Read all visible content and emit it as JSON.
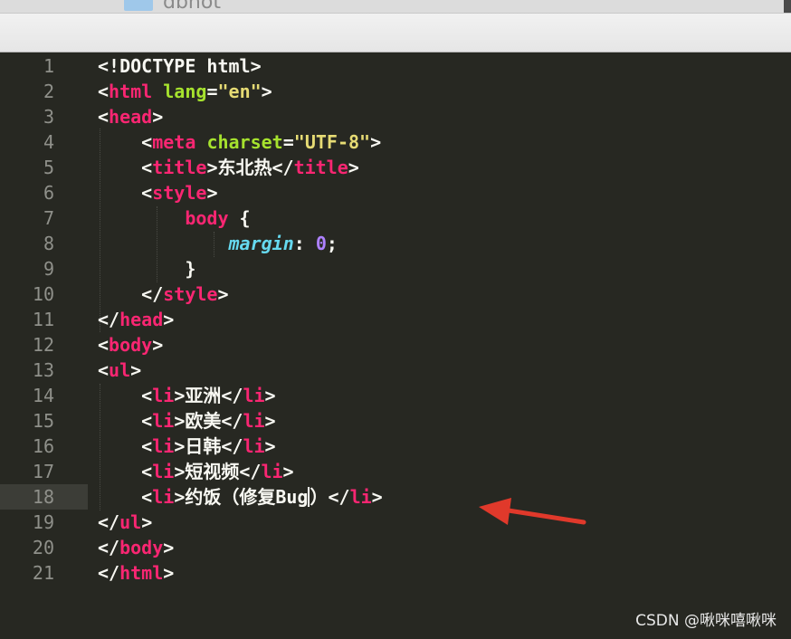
{
  "finder": {
    "folder_name": "dbhot"
  },
  "editor": {
    "active_line": "18",
    "lines": [
      {
        "num": "1",
        "segs": [
          {
            "c": "w",
            "t": "<!DOCTYPE html>"
          }
        ]
      },
      {
        "num": "2",
        "segs": [
          {
            "c": "w",
            "t": "<"
          },
          {
            "c": "t",
            "t": "html"
          },
          {
            "c": "w",
            "t": " "
          },
          {
            "c": "a",
            "t": "lang"
          },
          {
            "c": "w",
            "t": "="
          },
          {
            "c": "s",
            "t": "\"en\""
          },
          {
            "c": "w",
            "t": ">"
          }
        ]
      },
      {
        "num": "3",
        "segs": [
          {
            "c": "w",
            "t": "<"
          },
          {
            "c": "t",
            "t": "head"
          },
          {
            "c": "w",
            "t": ">"
          }
        ]
      },
      {
        "num": "4",
        "segs": [
          {
            "c": "w",
            "t": "    <"
          },
          {
            "c": "t",
            "t": "meta"
          },
          {
            "c": "w",
            "t": " "
          },
          {
            "c": "a",
            "t": "charset"
          },
          {
            "c": "w",
            "t": "="
          },
          {
            "c": "s",
            "t": "\"UTF-8\""
          },
          {
            "c": "w",
            "t": ">"
          }
        ]
      },
      {
        "num": "5",
        "segs": [
          {
            "c": "w",
            "t": "    <"
          },
          {
            "c": "t",
            "t": "title"
          },
          {
            "c": "w",
            "t": ">东北热</"
          },
          {
            "c": "t",
            "t": "title"
          },
          {
            "c": "w",
            "t": ">"
          }
        ]
      },
      {
        "num": "6",
        "segs": [
          {
            "c": "w",
            "t": "    <"
          },
          {
            "c": "t",
            "t": "style"
          },
          {
            "c": "w",
            "t": ">"
          }
        ]
      },
      {
        "num": "7",
        "segs": [
          {
            "c": "w",
            "t": "        "
          },
          {
            "c": "t",
            "t": "body"
          },
          {
            "c": "w",
            "t": " {"
          }
        ]
      },
      {
        "num": "8",
        "segs": [
          {
            "c": "w",
            "t": "            "
          },
          {
            "c": "p",
            "t": "margin"
          },
          {
            "c": "w",
            "t": ": "
          },
          {
            "c": "n",
            "t": "0"
          },
          {
            "c": "w",
            "t": ";"
          }
        ]
      },
      {
        "num": "9",
        "segs": [
          {
            "c": "w",
            "t": "        }"
          }
        ]
      },
      {
        "num": "10",
        "segs": [
          {
            "c": "w",
            "t": "    </"
          },
          {
            "c": "t",
            "t": "style"
          },
          {
            "c": "w",
            "t": ">"
          }
        ]
      },
      {
        "num": "11",
        "segs": [
          {
            "c": "w",
            "t": "</"
          },
          {
            "c": "t",
            "t": "head"
          },
          {
            "c": "w",
            "t": ">"
          }
        ]
      },
      {
        "num": "12",
        "segs": [
          {
            "c": "w",
            "t": "<"
          },
          {
            "c": "t",
            "t": "body"
          },
          {
            "c": "w",
            "t": ">"
          }
        ]
      },
      {
        "num": "13",
        "segs": [
          {
            "c": "w",
            "t": "<"
          },
          {
            "c": "t",
            "t": "ul"
          },
          {
            "c": "w",
            "t": ">"
          }
        ]
      },
      {
        "num": "14",
        "segs": [
          {
            "c": "w",
            "t": "    <"
          },
          {
            "c": "t",
            "t": "li"
          },
          {
            "c": "w",
            "t": ">亚洲</"
          },
          {
            "c": "t",
            "t": "li"
          },
          {
            "c": "w",
            "t": ">"
          }
        ]
      },
      {
        "num": "15",
        "segs": [
          {
            "c": "w",
            "t": "    <"
          },
          {
            "c": "t",
            "t": "li"
          },
          {
            "c": "w",
            "t": ">欧美</"
          },
          {
            "c": "t",
            "t": "li"
          },
          {
            "c": "w",
            "t": ">"
          }
        ]
      },
      {
        "num": "16",
        "segs": [
          {
            "c": "w",
            "t": "    <"
          },
          {
            "c": "t",
            "t": "li"
          },
          {
            "c": "w",
            "t": ">日韩</"
          },
          {
            "c": "t",
            "t": "li"
          },
          {
            "c": "w",
            "t": ">"
          }
        ]
      },
      {
        "num": "17",
        "segs": [
          {
            "c": "w",
            "t": "    <"
          },
          {
            "c": "t",
            "t": "li"
          },
          {
            "c": "w",
            "t": ">短视频</"
          },
          {
            "c": "t",
            "t": "li"
          },
          {
            "c": "w",
            "t": ">"
          }
        ]
      },
      {
        "num": "18",
        "segs": [
          {
            "c": "w",
            "t": "    <"
          },
          {
            "c": "t",
            "t": "li"
          },
          {
            "c": "w",
            "t": ">约饭（修复Bug"
          },
          {
            "c": "caret",
            "t": ""
          },
          {
            "c": "w",
            "t": "）</"
          },
          {
            "c": "t",
            "t": "li"
          },
          {
            "c": "w",
            "t": ">"
          }
        ]
      },
      {
        "num": "19",
        "segs": [
          {
            "c": "w",
            "t": "</"
          },
          {
            "c": "t",
            "t": "ul"
          },
          {
            "c": "w",
            "t": ">"
          }
        ]
      },
      {
        "num": "20",
        "segs": [
          {
            "c": "w",
            "t": "</"
          },
          {
            "c": "t",
            "t": "body"
          },
          {
            "c": "w",
            "t": ">"
          }
        ]
      },
      {
        "num": "21",
        "segs": [
          {
            "c": "w",
            "t": "</"
          },
          {
            "c": "t",
            "t": "html"
          },
          {
            "c": "w",
            "t": ">"
          }
        ]
      }
    ]
  },
  "annotation": {
    "color": "#e0392b"
  },
  "watermark": "CSDN @啾咪嘻啾咪"
}
